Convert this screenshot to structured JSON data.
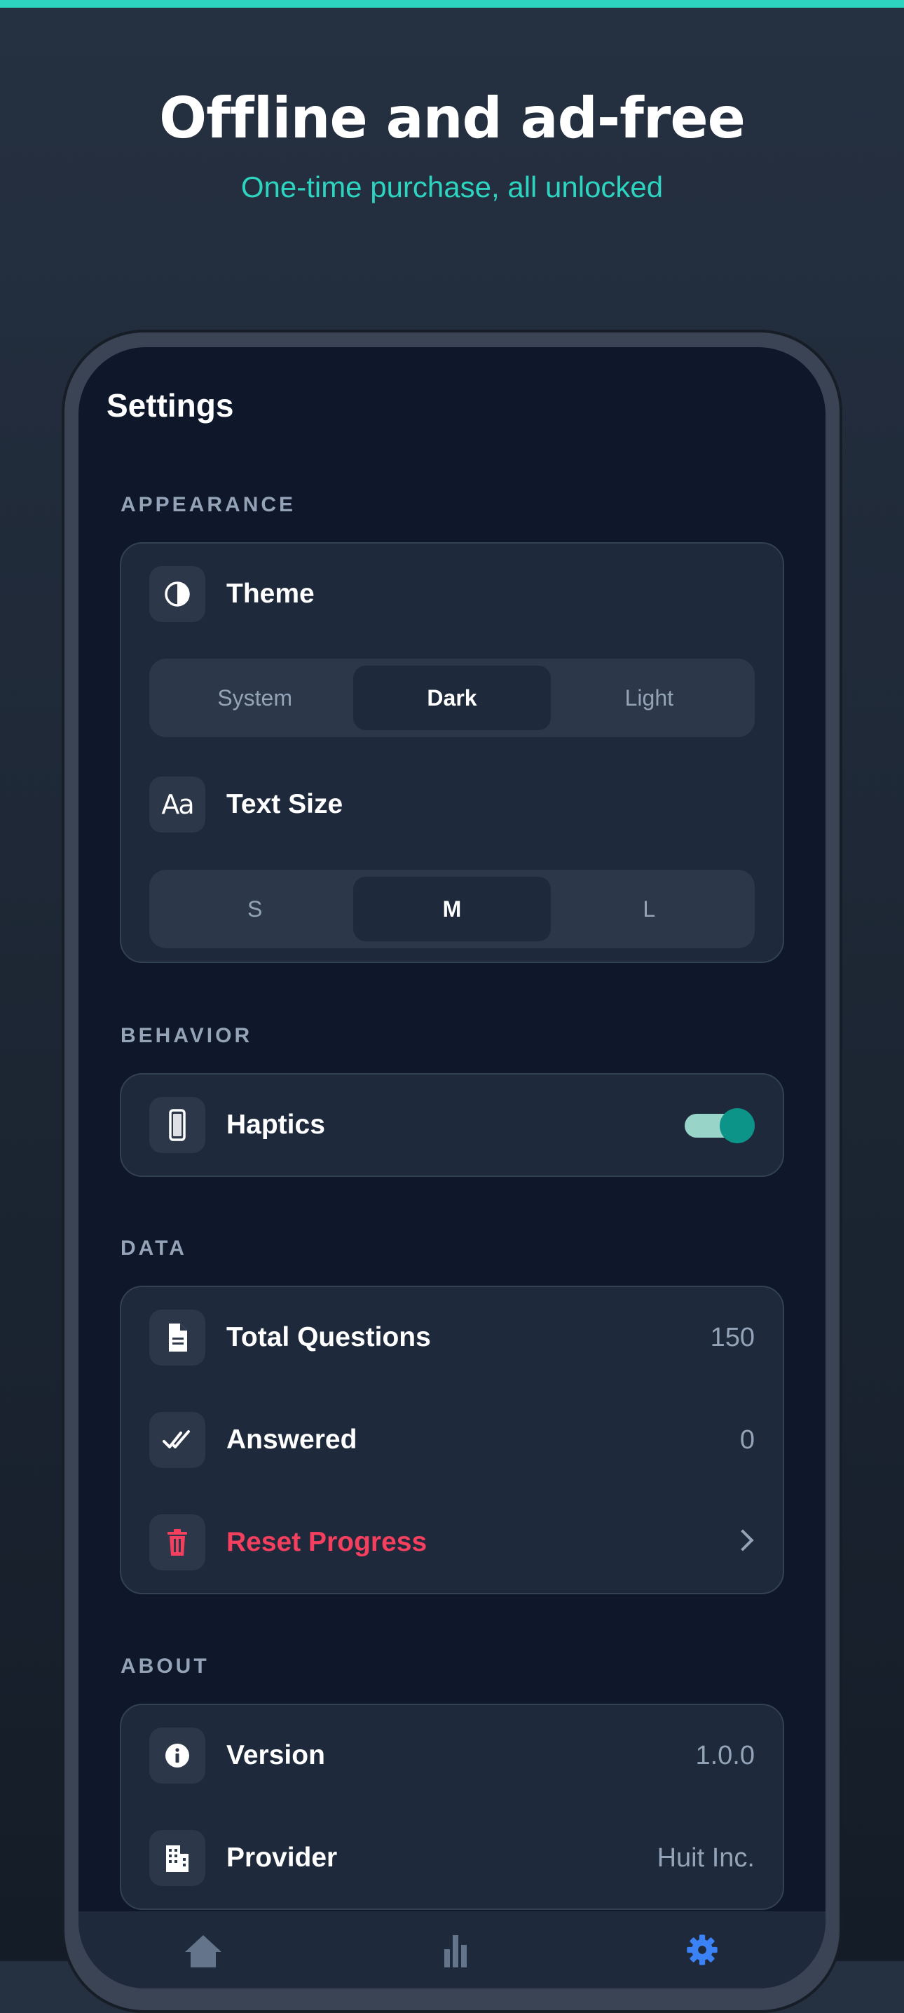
{
  "promo": {
    "headline": "Offline and ad-free",
    "subheadline": "One-time purchase, all unlocked"
  },
  "colors": {
    "accent": "#2dd4bf",
    "toggle_on": "#0d9488",
    "danger": "#f43f5e",
    "active_tab": "#3b82f6"
  },
  "screen": {
    "title": "Settings",
    "sections": {
      "appearance": {
        "label": "APPEARANCE",
        "theme": {
          "label": "Theme",
          "icon": "contrast-icon",
          "options": [
            "System",
            "Dark",
            "Light"
          ],
          "selected": "Dark"
        },
        "text_size": {
          "label": "Text Size",
          "icon": "text-size-icon",
          "options": [
            "S",
            "M",
            "L"
          ],
          "selected": "M"
        }
      },
      "behavior": {
        "label": "BEHAVIOR",
        "haptics": {
          "label": "Haptics",
          "icon": "phone-icon",
          "enabled": true
        }
      },
      "data": {
        "label": "DATA",
        "total_questions": {
          "label": "Total Questions",
          "value": "150",
          "icon": "document-icon"
        },
        "answered": {
          "label": "Answered",
          "value": "0",
          "icon": "double-check-icon"
        },
        "reset": {
          "label": "Reset Progress",
          "icon": "trash-icon"
        }
      },
      "about": {
        "label": "ABOUT",
        "version": {
          "label": "Version",
          "value": "1.0.0",
          "icon": "info-icon"
        },
        "provider": {
          "label": "Provider",
          "value": "Huit Inc.",
          "icon": "building-icon"
        }
      }
    },
    "tabbar": {
      "tabs": [
        {
          "icon": "home-icon",
          "active": false
        },
        {
          "icon": "chart-icon",
          "active": false
        },
        {
          "icon": "gear-icon",
          "active": true
        }
      ]
    }
  }
}
